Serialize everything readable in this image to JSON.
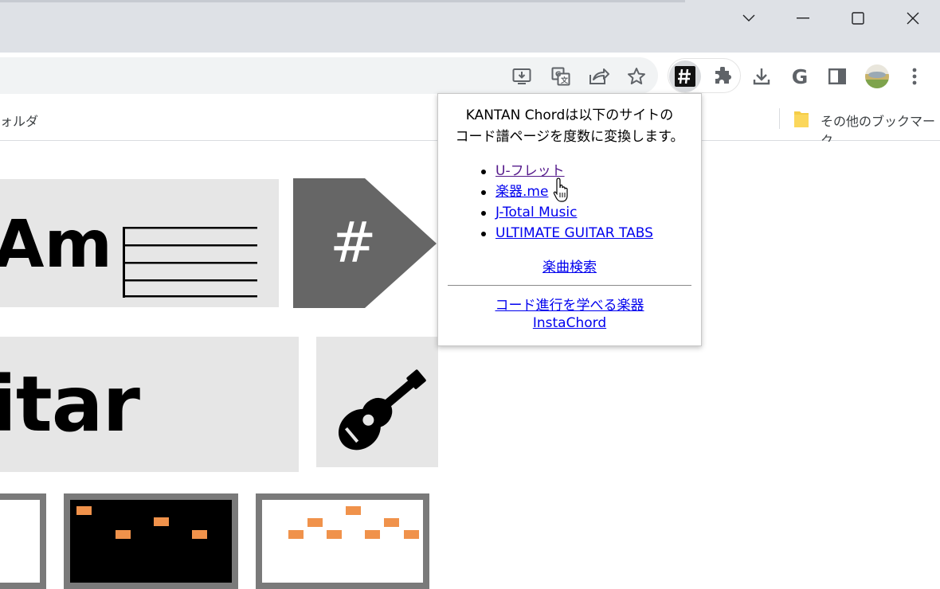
{
  "window": {
    "controls": [
      "chevron-down-icon",
      "minimize-icon",
      "maximize-icon",
      "close-icon"
    ]
  },
  "toolbar": {
    "icons": [
      "install-app-icon",
      "translate-icon",
      "share-icon",
      "star-icon",
      "kantan-chord-extension-icon",
      "puzzle-icon",
      "download-icon",
      "google-g-icon",
      "side-panel-icon",
      "profile-avatar-icon",
      "more-menu-icon"
    ],
    "google_letter": "G"
  },
  "bookmarks": {
    "left_item": "ォルダ",
    "right_item": "その他のブックマーク"
  },
  "page": {
    "chord_text": "Am",
    "sharp_symbol": "#",
    "guitar_text": "itar"
  },
  "popup": {
    "intro_line1": "KANTAN Chordは以下のサイトの",
    "intro_line2": "コード譜ページを度数に変換します。",
    "sites": [
      {
        "label": "U-フレット"
      },
      {
        "label": "楽器.me"
      },
      {
        "label": "J-Total Music"
      },
      {
        "label": "ULTIMATE GUITAR TABS"
      }
    ],
    "search_link": "楽曲検索",
    "learn_link": "コード進行を学べる楽器",
    "insta_link": "InstaChord"
  }
}
